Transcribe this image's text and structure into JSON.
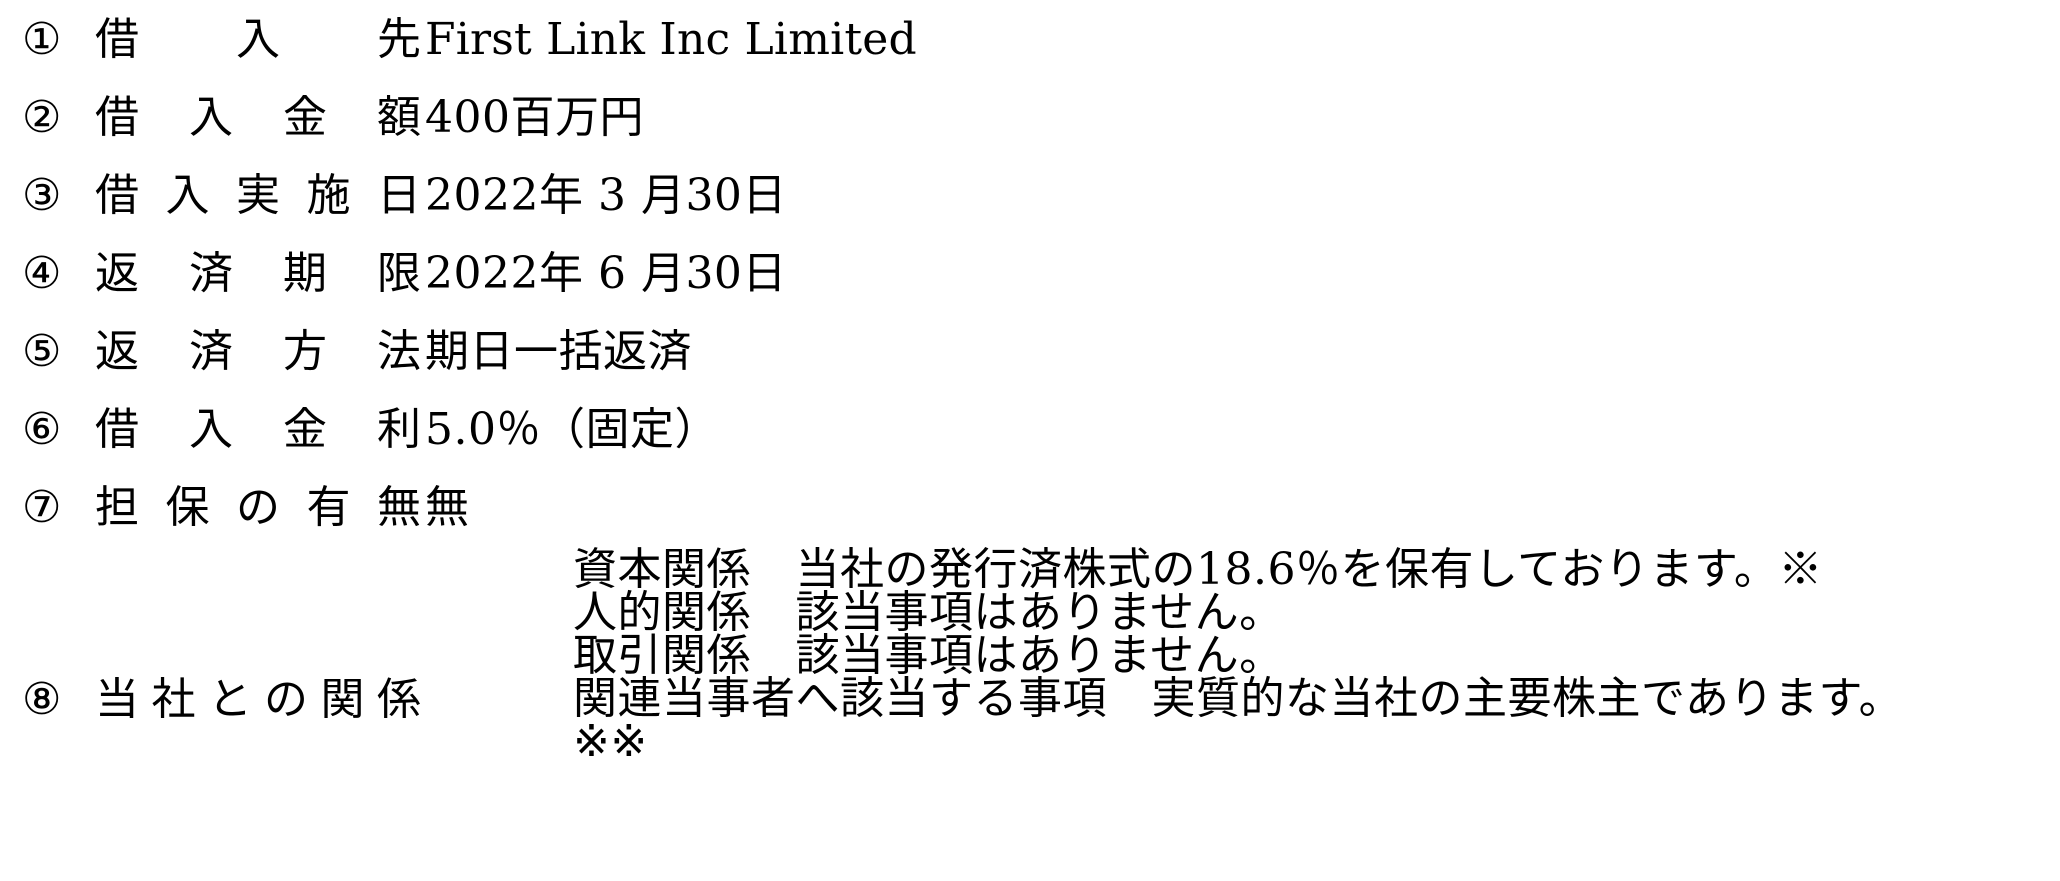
{
  "document": {
    "type": "borrowing-terms-list",
    "text_color": "#000000",
    "background_color": "#ffffff"
  },
  "items": [
    {
      "marker": "①",
      "label": "借入先",
      "value": "First Link Inc Limited",
      "script": "latin"
    },
    {
      "marker": "②",
      "label": "借入金額",
      "value": "400百万円",
      "script": "mixed"
    },
    {
      "marker": "③",
      "label": "借入実施日",
      "value": "2022年 3 月30日",
      "script": "mixed"
    },
    {
      "marker": "④",
      "label": "返済期限",
      "value": "2022年 6 月30日",
      "script": "mixed"
    },
    {
      "marker": "⑤",
      "label": "返済方法",
      "value": "期日一括返済",
      "script": "japanese"
    },
    {
      "marker": "⑥",
      "label": "借入金利",
      "value": "5.0％（固定）",
      "script": "mixed"
    },
    {
      "marker": "⑦",
      "label": "担保の有無",
      "value": "無",
      "script": "japanese"
    }
  ],
  "relationship": {
    "marker": "⑧",
    "label": "当社との関係",
    "lines": [
      "資本関係　当社の発行済株式の18.6％を保有しております。※",
      "人的関係　該当事項はありません。",
      "取引関係　該当事項はありません。",
      "関連当事者へ該当する事項　実質的な当社の主要株主であります。",
      "※※"
    ]
  }
}
